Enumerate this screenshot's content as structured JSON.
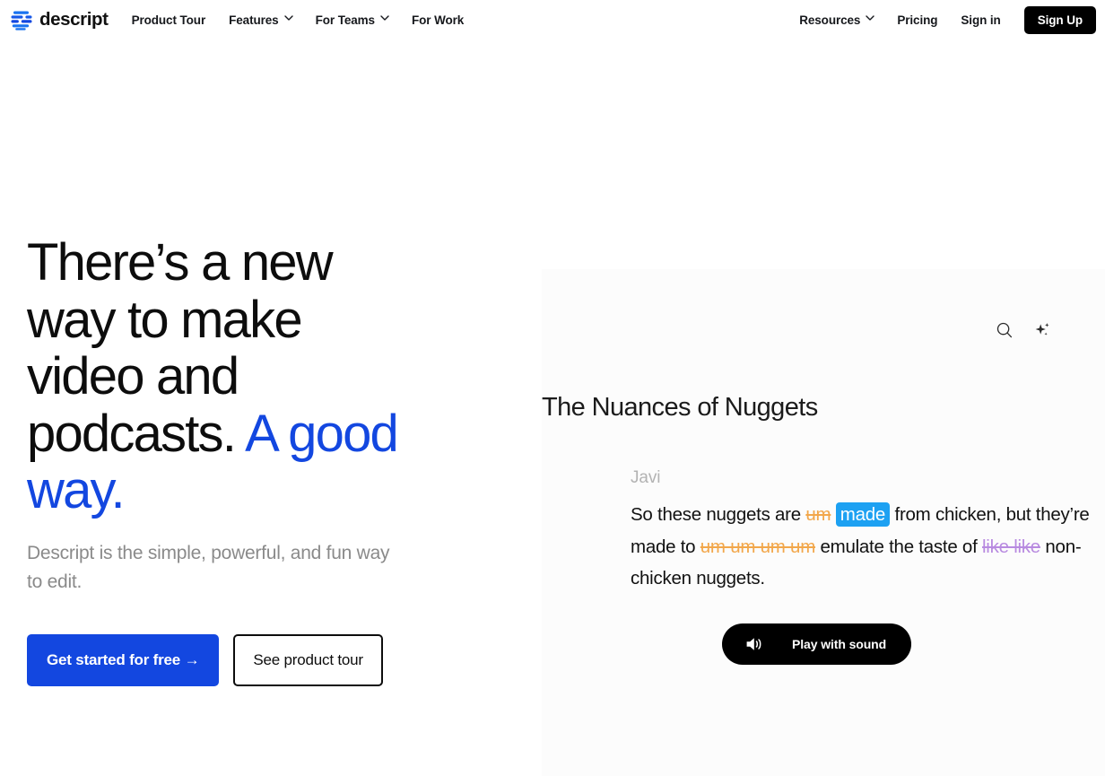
{
  "brand": {
    "name": "descript",
    "logo_icon": "descript-logo-icon",
    "accent_color": "#1347e0"
  },
  "navbar": {
    "links": [
      {
        "label": "Product Tour",
        "has_dropdown": false
      },
      {
        "label": "Features",
        "has_dropdown": true
      },
      {
        "label": "For Teams",
        "has_dropdown": true
      },
      {
        "label": "For Work",
        "has_dropdown": false
      }
    ],
    "right_links": [
      {
        "label": "Resources",
        "has_dropdown": true
      },
      {
        "label": "Pricing",
        "has_dropdown": false
      },
      {
        "label": "Sign in",
        "has_dropdown": false
      }
    ],
    "signup_label": "Sign Up"
  },
  "hero": {
    "headline_part1": "There’s a new way to make video and podcasts. ",
    "headline_accent": "A good way.",
    "subhead": "Descript is the simple, powerful, and fun way to edit.",
    "cta_primary": "Get started for free →",
    "cta_secondary": "See product tour"
  },
  "app_panel": {
    "toolbar": [
      {
        "icon": "search-icon",
        "label": "Search"
      },
      {
        "icon": "sparkle-ai-icon",
        "label": "AI actions"
      }
    ],
    "document_title": "The Nuances of Nuggets",
    "transcript": {
      "speaker": "Javi",
      "segments": [
        {
          "text": "So these nuggets are ",
          "style": "normal"
        },
        {
          "text": "um",
          "style": "strike-orange"
        },
        {
          "text": " ",
          "style": "normal"
        },
        {
          "text": "made",
          "style": "highlight-blue"
        },
        {
          "text": " from chicken, but they’re made to ",
          "style": "normal"
        },
        {
          "text": "um um um um",
          "style": "strike-orange"
        },
        {
          "text": " emulate the taste of ",
          "style": "normal"
        },
        {
          "text": "like like",
          "style": "strike-purple"
        },
        {
          "text": " non-chicken nuggets.",
          "style": "normal"
        }
      ]
    },
    "play_button": {
      "label": "Play with sound",
      "icon": "speaker-sound-icon"
    },
    "colors": {
      "filler_word": "#f2a74b",
      "crutch_word": "#b88ae0",
      "highlight": "#1da1f2",
      "panel_background": "#fcfcfc"
    }
  }
}
